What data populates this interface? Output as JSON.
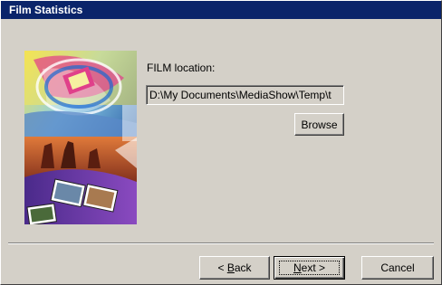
{
  "window": {
    "title": "Film Statistics"
  },
  "main": {
    "location_label": "FILM location:",
    "location_value": "D:\\My Documents\\MediaShow\\Temp\\t",
    "browse_label": "Browse"
  },
  "footer": {
    "back_mnemonic": "B",
    "back_rest": "ack",
    "back_prefix": "< ",
    "next_mnemonic": "N",
    "next_rest": "ext",
    "next_suffix": " >",
    "cancel_label": "Cancel"
  },
  "colors": {
    "title_bar": "#0a246a",
    "face": "#d4d0c8"
  }
}
